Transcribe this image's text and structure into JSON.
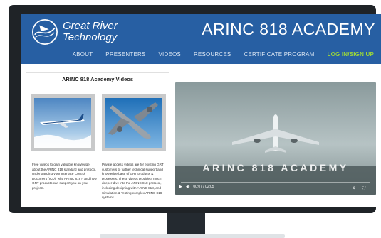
{
  "site": {
    "logo_line1": "Great River",
    "logo_line2": "Technology",
    "title": "ARINC 818 ACADEMY"
  },
  "nav": {
    "items": [
      "ABOUT",
      "PRESENTERS",
      "VIDEOS",
      "RESOURCES",
      "CERTIFICATE PROGRAM"
    ],
    "login": "LOG IN/SIGN UP",
    "login_color": "#9bd63a"
  },
  "panel": {
    "title": "ARINC 818 Academy Videos",
    "free_desc": "Free videos to gain valuable knowledge about the ARINC 818 standard and protocol, understanding your Interface Control Document (ICD), why ARINC 818?, and how GRT products can support you on your projects.",
    "private_desc": "Private access videos are for existing GRT customers to further technical support and knowledge base of GRT products & processes. These videos provide a much deeper dive into the ARINC 818 protocol, including designing with ARINC 818, and Simulation & Testing complex ARINC 818 systems."
  },
  "video": {
    "title": "ARINC 818 ACADEMY",
    "time": "00:07 / 02:05",
    "progress": 0.056
  },
  "colors": {
    "header_bg": "#275fa3",
    "monitor": "#1f2327"
  }
}
